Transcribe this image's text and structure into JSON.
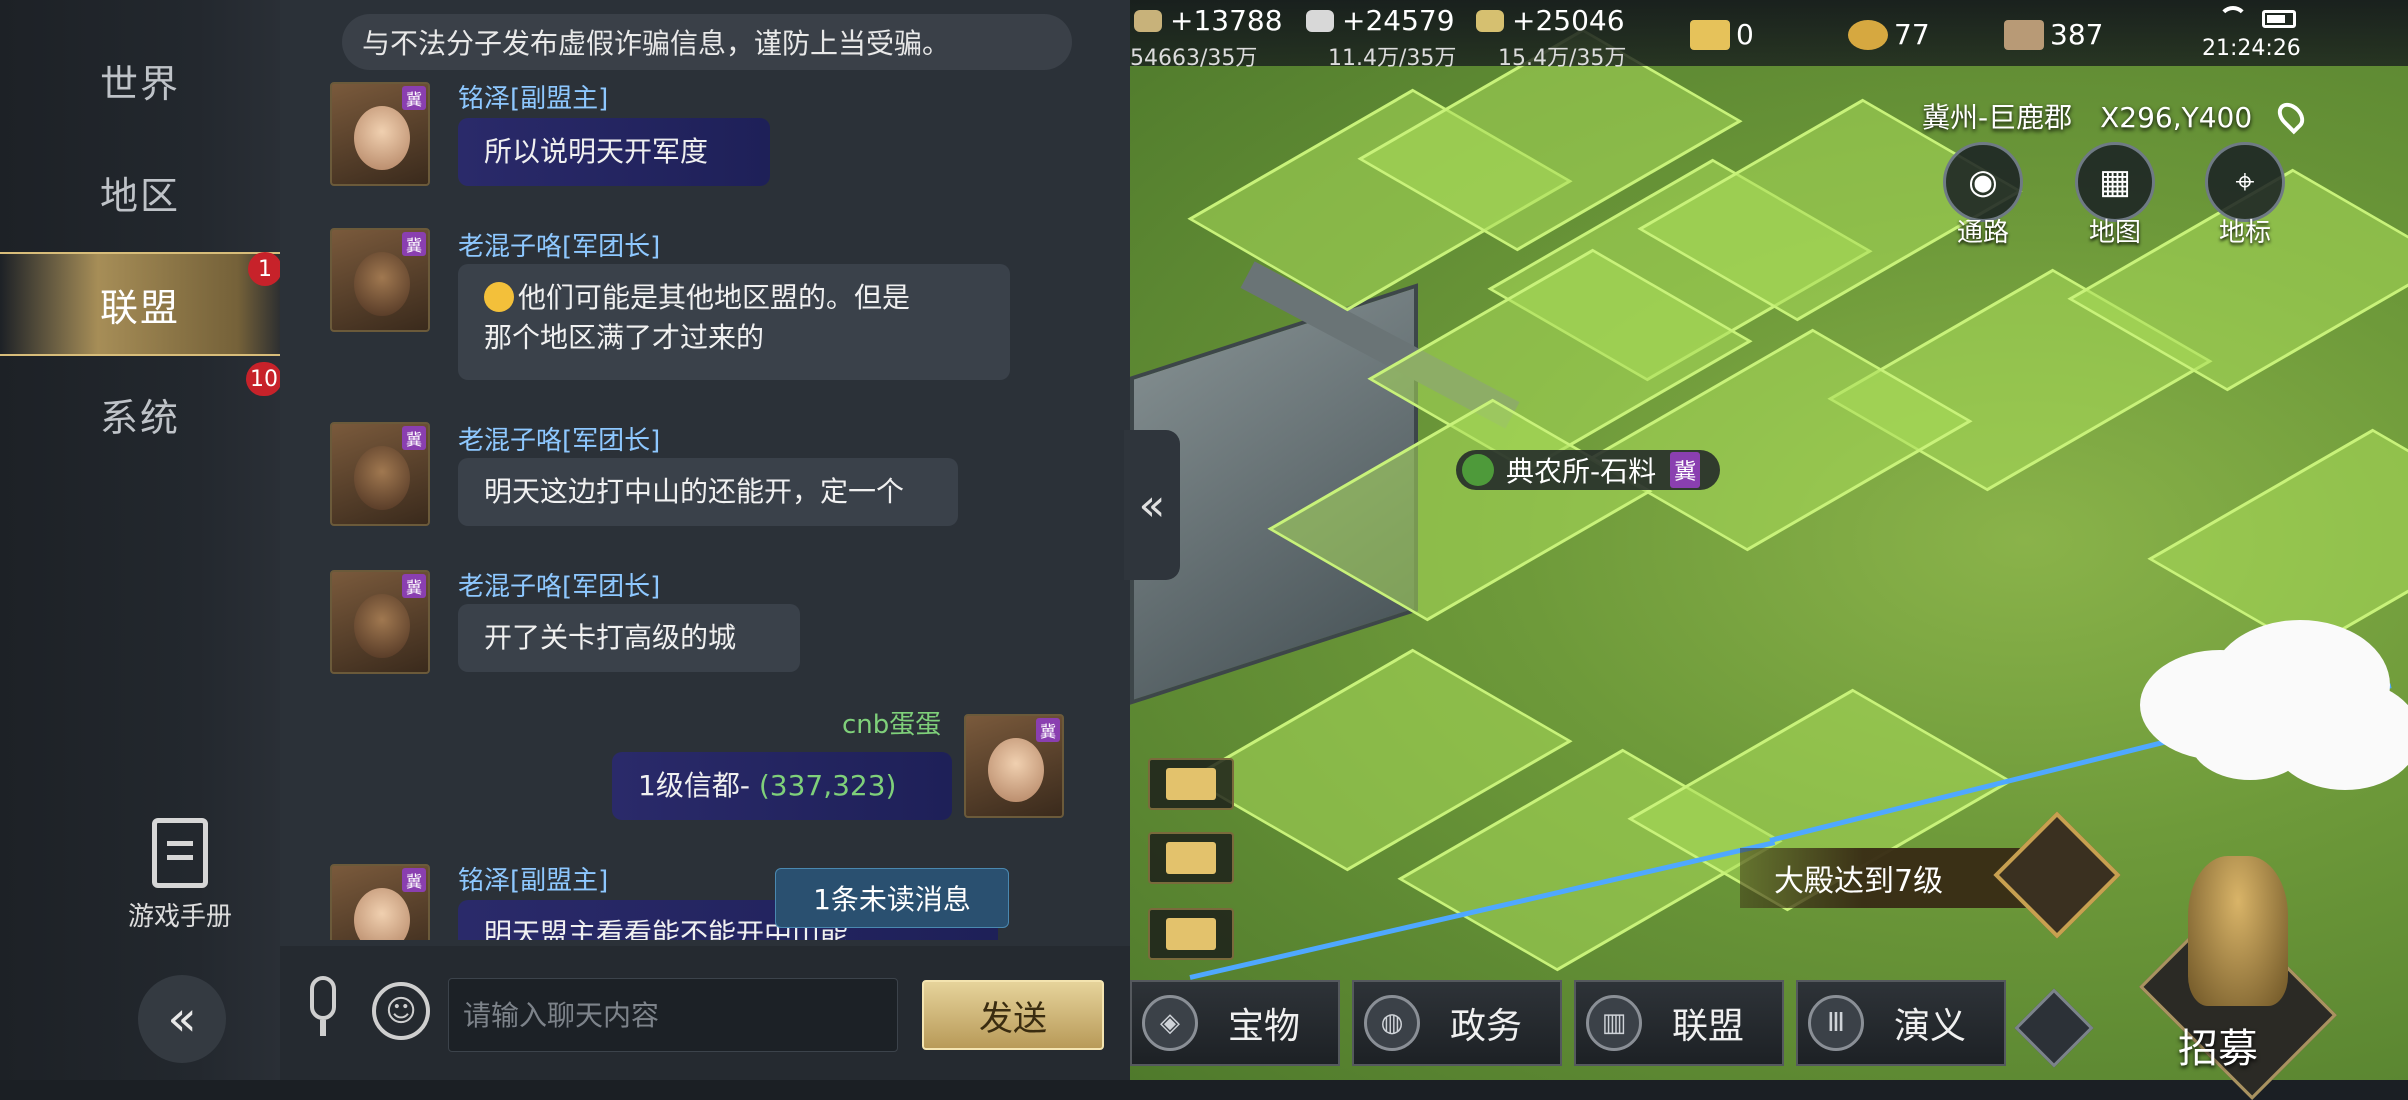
{
  "left_tabs": [
    {
      "label": "世界",
      "badge": null
    },
    {
      "label": "地区",
      "badge": null
    },
    {
      "label": "联盟",
      "badge": "1"
    },
    {
      "label": "系统",
      "badge": "10"
    }
  ],
  "manual_label": "游戏手册",
  "collapse_left_glyph": "«",
  "chat": {
    "notice": "与不法分子发布虚假诈骗信息，谨防上当受骗。",
    "avatar_seal": "冀",
    "messages": [
      {
        "sender": "铭泽[副盟主]",
        "text": "所以说明天开军度"
      },
      {
        "sender": "老混子咯[军团长]",
        "text": "他们可能是其他地区盟的。但是",
        "text2": "那个地区满了才过来的"
      },
      {
        "sender": "老混子咯[军团长]",
        "text": "明天这边打中山的还能开，定一个"
      },
      {
        "sender": "老混子咯[军团长]",
        "text": "开了关卡打高级的城"
      },
      {
        "sender": "cnb蛋蛋",
        "text": "1级信都-",
        "coords": "(337,323)"
      },
      {
        "sender": "铭泽[副盟主]",
        "text": "明天盟主看看能不能开中山能"
      }
    ],
    "unread": "1条未读消息",
    "input_placeholder": "请输入聊天内容",
    "send_label": "发送",
    "emoji_glyph": "☺",
    "collapse_glyph": "«"
  },
  "topbar": {
    "resources": [
      {
        "icon": "wood-icon",
        "value": "+13788",
        "sub": "54663/35万",
        "color": "#c8b27a"
      },
      {
        "icon": "iron-icon",
        "value": "+24579",
        "sub": "11.4万/35万",
        "color": "#d8d8d8"
      },
      {
        "icon": "grain-icon",
        "value": "+25046",
        "sub": "15.4万/35万",
        "color": "#d6c070"
      }
    ],
    "currencies": [
      {
        "icon": "gold-bar-icon",
        "value": "0",
        "color": "#e6c25a"
      },
      {
        "icon": "jade-icon",
        "value": "77",
        "color": "#d6a840"
      },
      {
        "icon": "copper-icon",
        "value": "387",
        "color": "#b89a76"
      }
    ],
    "clock": "21:24:26"
  },
  "location": "冀州-巨鹿郡　X296,Y400",
  "map_buttons": [
    {
      "label": "通路",
      "glyph": "◉"
    },
    {
      "label": "地图",
      "glyph": "▦"
    },
    {
      "label": "地标",
      "glyph": "⌖"
    }
  ],
  "fort_label": {
    "text": "典农所-石料",
    "seal": "冀"
  },
  "quest_text": "大殿达到7级",
  "bottom_buttons": [
    {
      "label": "宝物",
      "glyph": "◈"
    },
    {
      "label": "政务",
      "glyph": "◍"
    },
    {
      "label": "联盟",
      "glyph": "▥"
    },
    {
      "label": "演义",
      "glyph": "Ⅲ"
    }
  ],
  "recruit_label": "招募"
}
